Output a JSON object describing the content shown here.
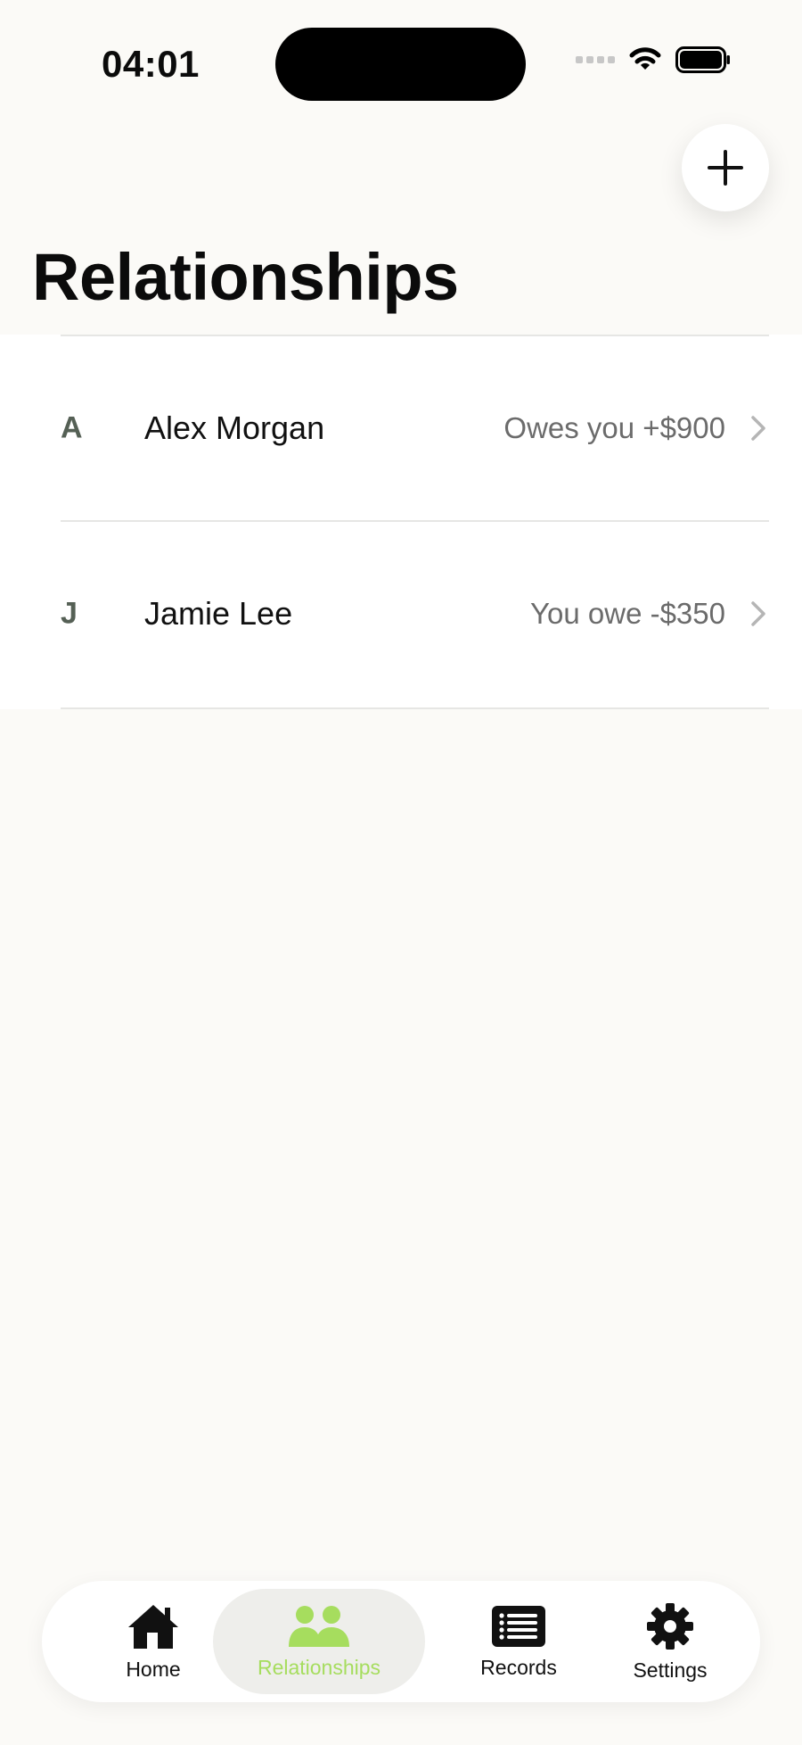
{
  "status_bar": {
    "time": "04:01"
  },
  "page": {
    "title": "Relationships"
  },
  "relationships": [
    {
      "initial": "A",
      "name": "Alex Morgan",
      "balance": "Owes you +$900"
    },
    {
      "initial": "J",
      "name": "Jamie Lee",
      "balance": "You owe -$350"
    }
  ],
  "tabs": [
    {
      "label": "Home",
      "icon": "house-icon",
      "active": false
    },
    {
      "label": "Relationships",
      "icon": "people-icon",
      "active": true
    },
    {
      "label": "Records",
      "icon": "list-icon",
      "active": false
    },
    {
      "label": "Settings",
      "icon": "gear-icon",
      "active": false
    }
  ],
  "colors": {
    "accent": "#A6DD5E",
    "background": "#FBFAF7",
    "active_tab_bg": "#EEEEEB"
  },
  "icons": {
    "add": "plus-icon",
    "chevron": "chevron-right-icon",
    "wifi": "wifi-icon",
    "battery": "battery-icon",
    "signal": "cellular-signal-icon"
  }
}
